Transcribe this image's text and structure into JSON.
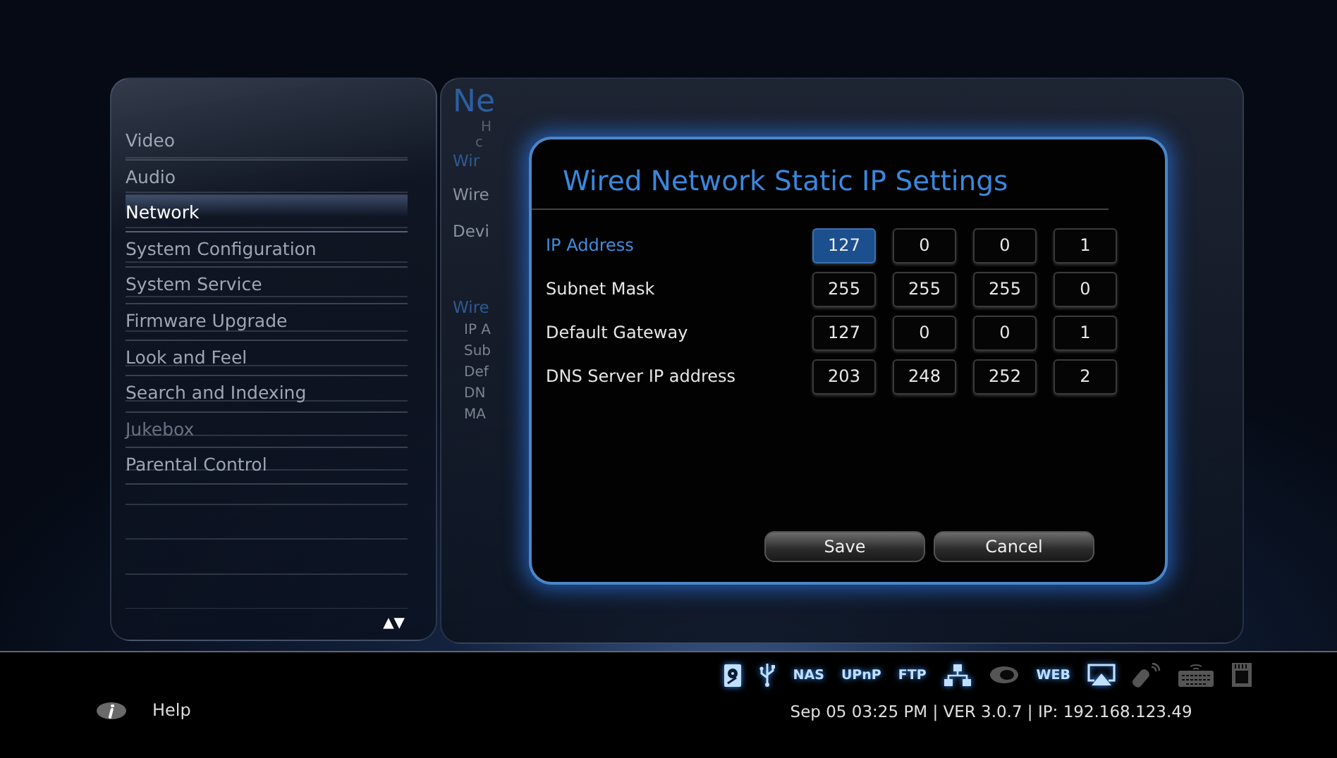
{
  "sidebar": {
    "items": [
      {
        "label": "Video",
        "selected": false,
        "disabled": false
      },
      {
        "label": "Audio",
        "selected": false,
        "disabled": false
      },
      {
        "label": "Network",
        "selected": true,
        "disabled": false
      },
      {
        "label": "System Configuration",
        "selected": false,
        "disabled": false
      },
      {
        "label": "System Service",
        "selected": false,
        "disabled": false
      },
      {
        "label": "Firmware Upgrade",
        "selected": false,
        "disabled": false
      },
      {
        "label": "Look and Feel",
        "selected": false,
        "disabled": false
      },
      {
        "label": "Search and Indexing",
        "selected": false,
        "disabled": false
      },
      {
        "label": "Jukebox",
        "selected": false,
        "disabled": true
      },
      {
        "label": "Parental Control",
        "selected": false,
        "disabled": false
      }
    ],
    "scroll_arrows": "▲▼"
  },
  "background_panel": {
    "title": "Ne",
    "description": [
      "H",
      "c"
    ],
    "lines": [
      {
        "text": "Wir",
        "kind": "heading"
      },
      {
        "text": "Wire",
        "kind": "item"
      },
      {
        "text": "Devi",
        "kind": "item"
      },
      {
        "text": "Wire",
        "kind": "heading"
      },
      {
        "text": "IP A",
        "kind": "sub"
      },
      {
        "text": "Sub",
        "kind": "sub"
      },
      {
        "text": "Def",
        "kind": "sub"
      },
      {
        "text": "DN",
        "kind": "sub"
      },
      {
        "text": "MA",
        "kind": "sub"
      }
    ]
  },
  "dialog": {
    "title": "Wired Network Static IP Settings",
    "rows": [
      {
        "label": "IP Address",
        "selected": true,
        "octets": [
          {
            "value": "127",
            "selected": true
          },
          {
            "value": "0",
            "selected": false
          },
          {
            "value": "0",
            "selected": false
          },
          {
            "value": "1",
            "selected": false
          }
        ]
      },
      {
        "label": "Subnet Mask",
        "selected": false,
        "octets": [
          {
            "value": "255",
            "selected": false
          },
          {
            "value": "255",
            "selected": false
          },
          {
            "value": "255",
            "selected": false
          },
          {
            "value": "0",
            "selected": false
          }
        ]
      },
      {
        "label": "Default Gateway",
        "selected": false,
        "octets": [
          {
            "value": "127",
            "selected": false
          },
          {
            "value": "0",
            "selected": false
          },
          {
            "value": "0",
            "selected": false
          },
          {
            "value": "1",
            "selected": false
          }
        ]
      },
      {
        "label": "DNS Server IP address",
        "selected": false,
        "octets": [
          {
            "value": "203",
            "selected": false
          },
          {
            "value": "248",
            "selected": false
          },
          {
            "value": "252",
            "selected": false
          },
          {
            "value": "2",
            "selected": false
          }
        ]
      }
    ],
    "buttons": [
      "Save",
      "Cancel"
    ]
  },
  "status_icons": [
    {
      "kind": "hdd",
      "on": true
    },
    {
      "kind": "usb",
      "on": true
    },
    {
      "kind": "text",
      "text": "NAS",
      "on": true
    },
    {
      "kind": "text",
      "text": "UPnP",
      "on": true
    },
    {
      "kind": "text",
      "text": "FTP",
      "on": true
    },
    {
      "kind": "network",
      "on": true
    },
    {
      "kind": "wifi",
      "on": false
    },
    {
      "kind": "text",
      "text": "WEB",
      "on": true
    },
    {
      "kind": "screen",
      "on": true
    },
    {
      "kind": "remote",
      "on": false
    },
    {
      "kind": "keyboard",
      "on": false
    },
    {
      "kind": "card",
      "on": false
    }
  ],
  "help": {
    "label": "Help"
  },
  "status_bar": "Sep 05 03:25 PM | VER 3.0.7 | IP: 192.168.123.49"
}
